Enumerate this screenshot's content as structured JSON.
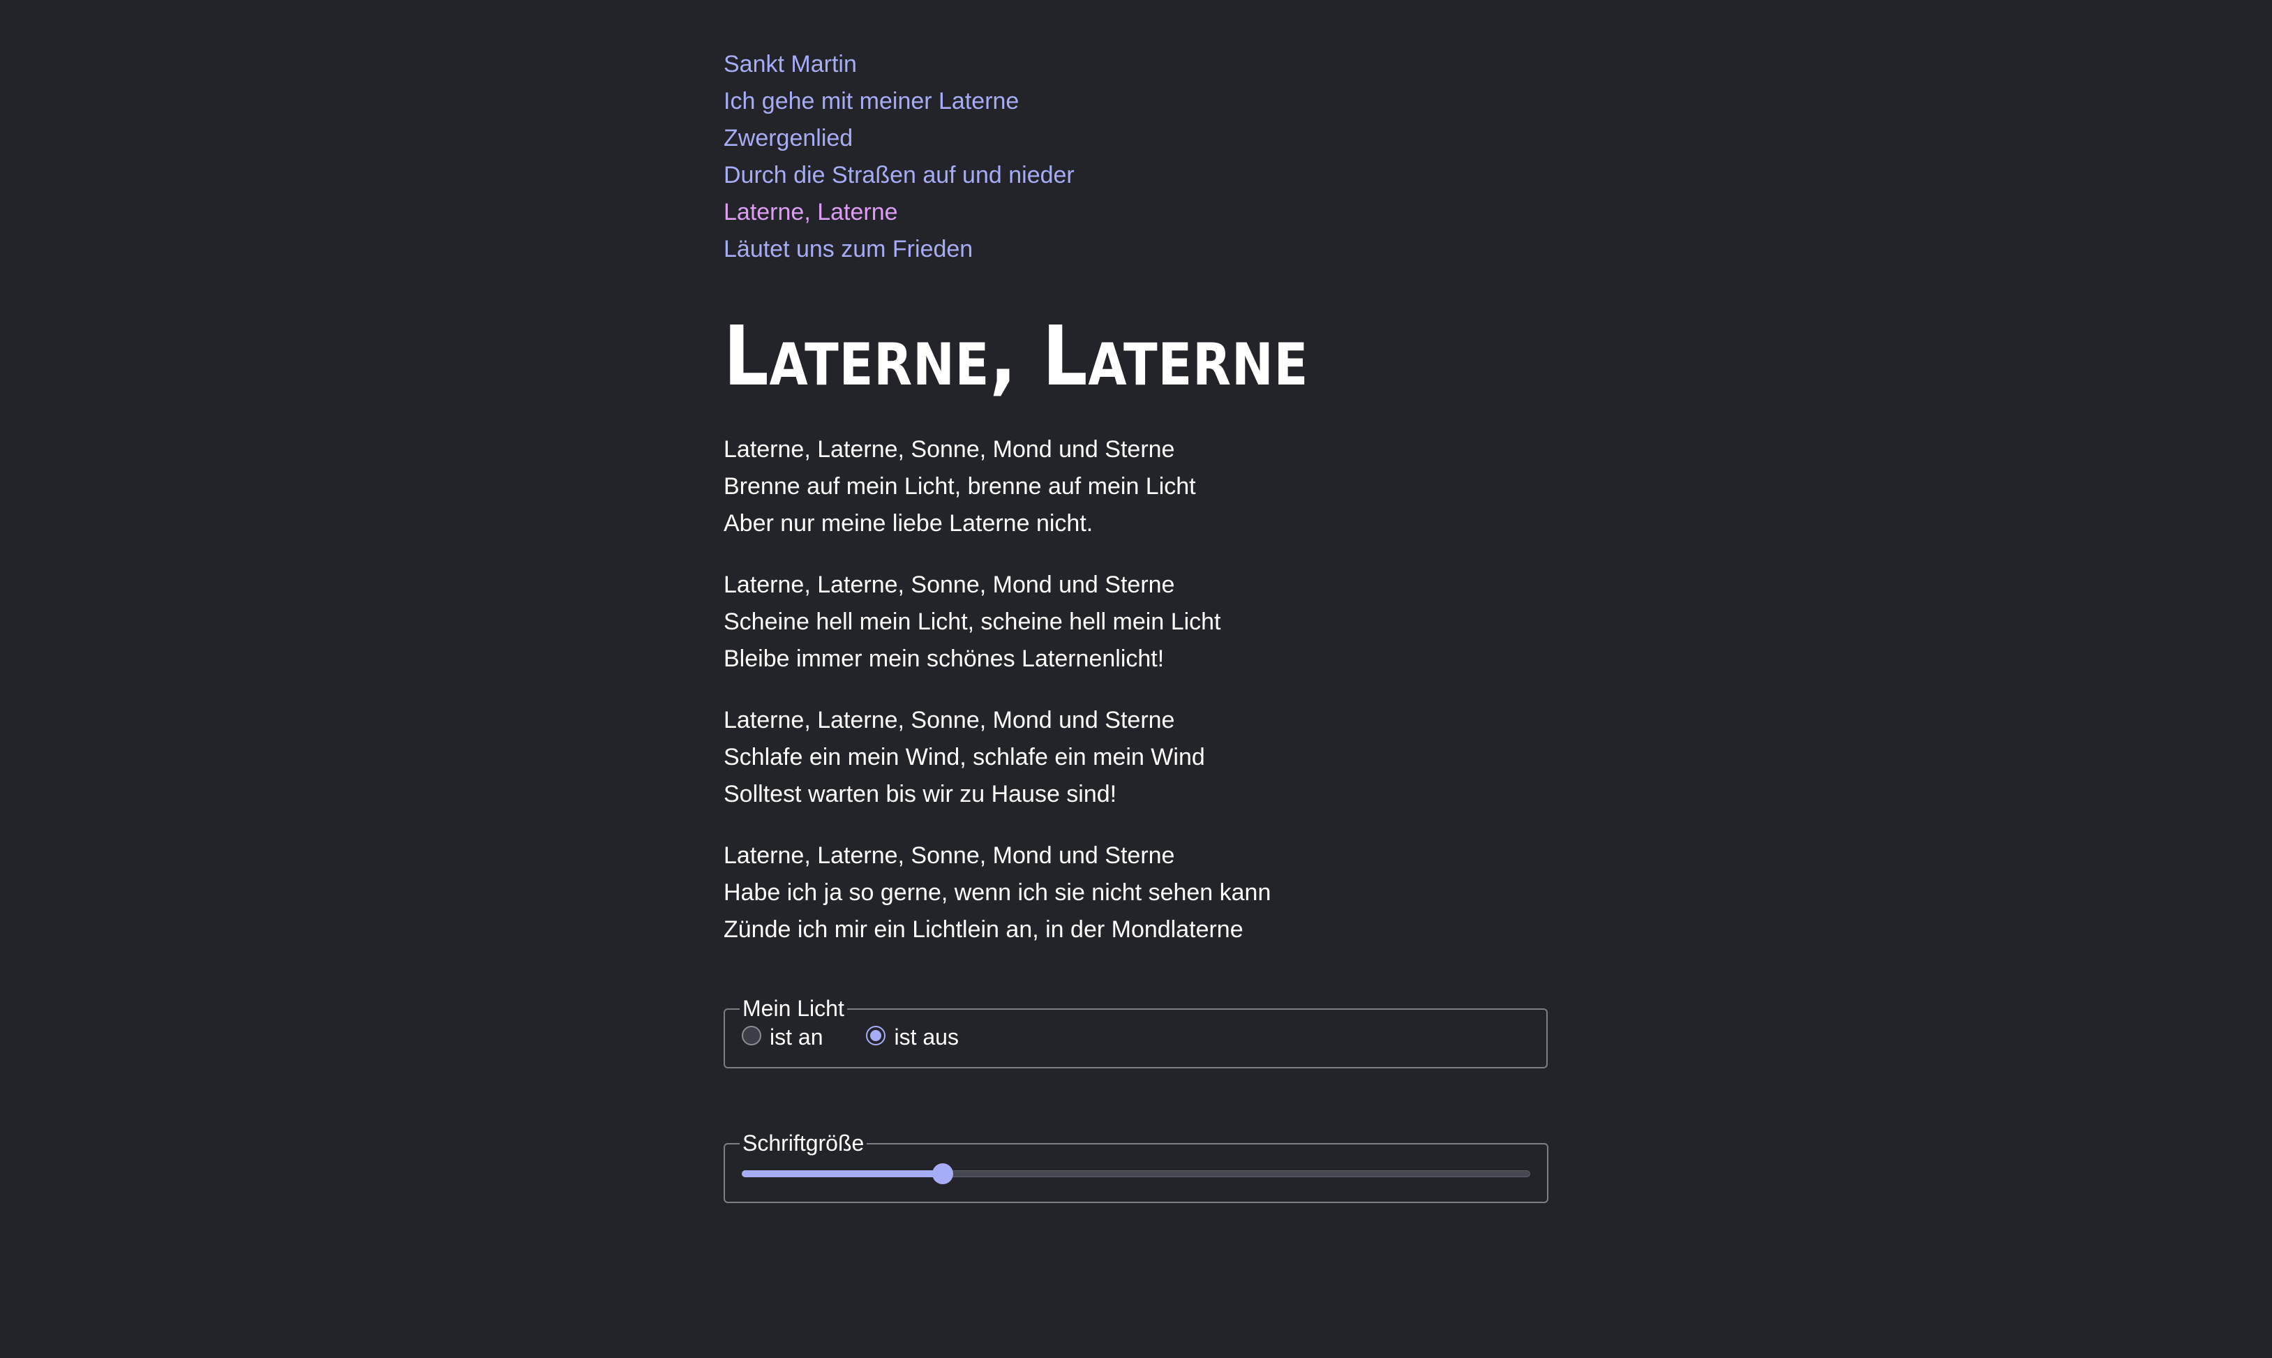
{
  "nav": {
    "items": [
      {
        "label": "Sankt Martin",
        "visited": false
      },
      {
        "label": "Ich gehe mit meiner Laterne",
        "visited": false
      },
      {
        "label": "Zwergenlied",
        "visited": false
      },
      {
        "label": "Durch die Straßen auf und nieder",
        "visited": false
      },
      {
        "label": "Laterne, Laterne",
        "visited": true
      },
      {
        "label": "Läutet uns zum Frieden",
        "visited": false
      }
    ]
  },
  "song": {
    "title": "Laterne, Laterne",
    "stanzas": [
      [
        "Laterne, Laterne, Sonne, Mond und Sterne",
        "Brenne auf mein Licht, brenne auf mein Licht",
        "Aber nur meine liebe Laterne nicht."
      ],
      [
        "Laterne, Laterne, Sonne, Mond und Sterne",
        "Scheine hell mein Licht, scheine hell mein Licht",
        "Bleibe immer mein schönes Laternenlicht!"
      ],
      [
        "Laterne, Laterne, Sonne, Mond und Sterne",
        "Schlafe ein mein Wind, schlafe ein mein Wind",
        "Solltest warten bis wir zu Hause sind!"
      ],
      [
        "Laterne, Laterne, Sonne, Mond und Sterne",
        "Habe ich ja so gerne, wenn ich sie nicht sehen kann",
        "Zünde ich mir ein Lichtlein an, in der Mondlaterne"
      ]
    ]
  },
  "light_control": {
    "legend": "Mein Licht",
    "options": [
      {
        "label": "ist an",
        "checked": false
      },
      {
        "label": "ist aus",
        "checked": true
      }
    ]
  },
  "font_size_control": {
    "legend": "Schriftgröße",
    "value_fraction": 0.255
  },
  "colors": {
    "background": "#222429",
    "link": "#a7adf5",
    "link_visited": "#df9df3",
    "accent": "#a7adf5",
    "text": "#ffffff"
  }
}
